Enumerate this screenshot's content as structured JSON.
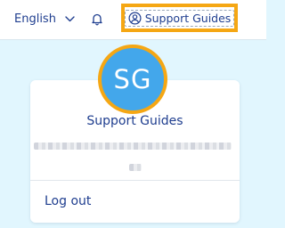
{
  "header": {
    "language_label": "English",
    "support_button_label": "Support Guides"
  },
  "icons": {
    "language_chevron": "chevron-down-icon",
    "notifications": "bell-icon",
    "support_user": "user-circle-icon"
  },
  "profile": {
    "avatar_initials": "SG",
    "name": "Support Guides",
    "logout_label": "Log out"
  },
  "colors": {
    "highlight": "#f5a714",
    "avatar_background": "#43a7eb",
    "text_primary": "#1f3e8f",
    "page_background": "#e1f6fe"
  }
}
